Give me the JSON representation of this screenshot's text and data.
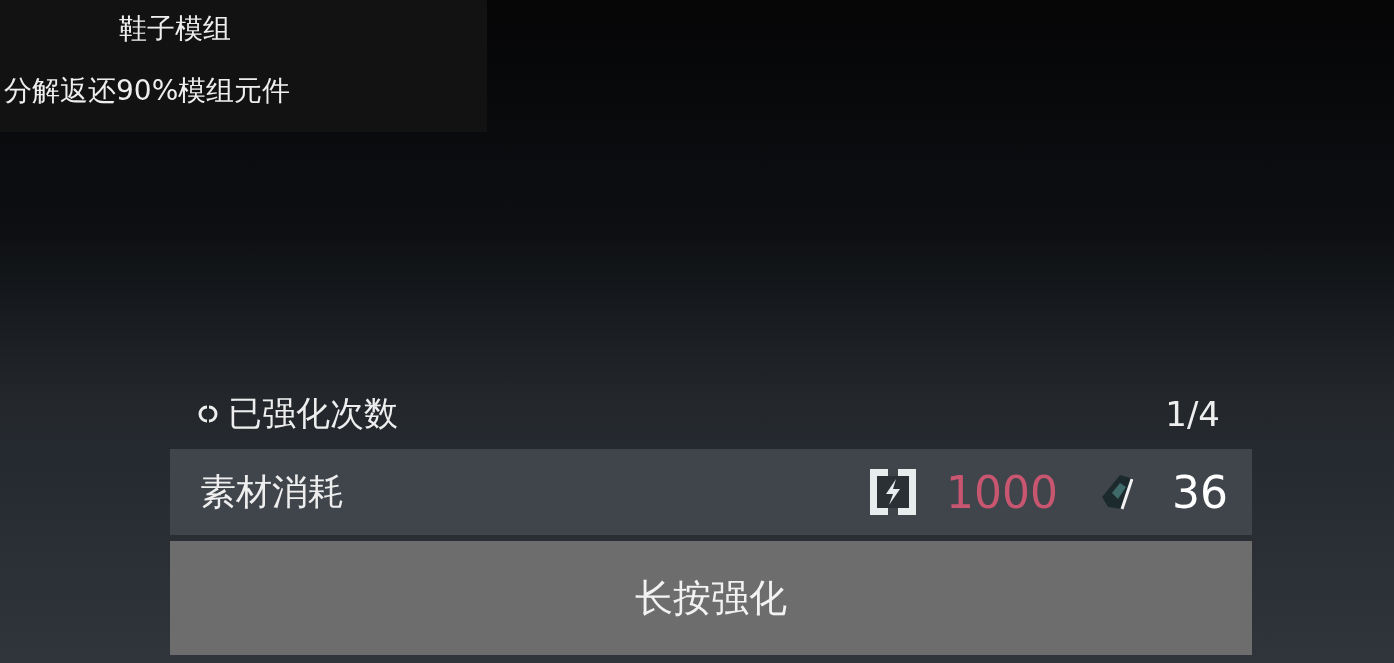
{
  "module_card": {
    "title": "鞋子模组",
    "description": "分解返还90%模组元件"
  },
  "enhance_count": {
    "label": "已强化次数",
    "value": "1/4"
  },
  "materials": {
    "label": "素材消耗",
    "costs": [
      {
        "kind": "energy",
        "amount": "1000",
        "insufficient": true
      },
      {
        "kind": "chip",
        "amount": "36",
        "insufficient": false
      }
    ]
  },
  "action_button": {
    "label": "长按强化"
  }
}
